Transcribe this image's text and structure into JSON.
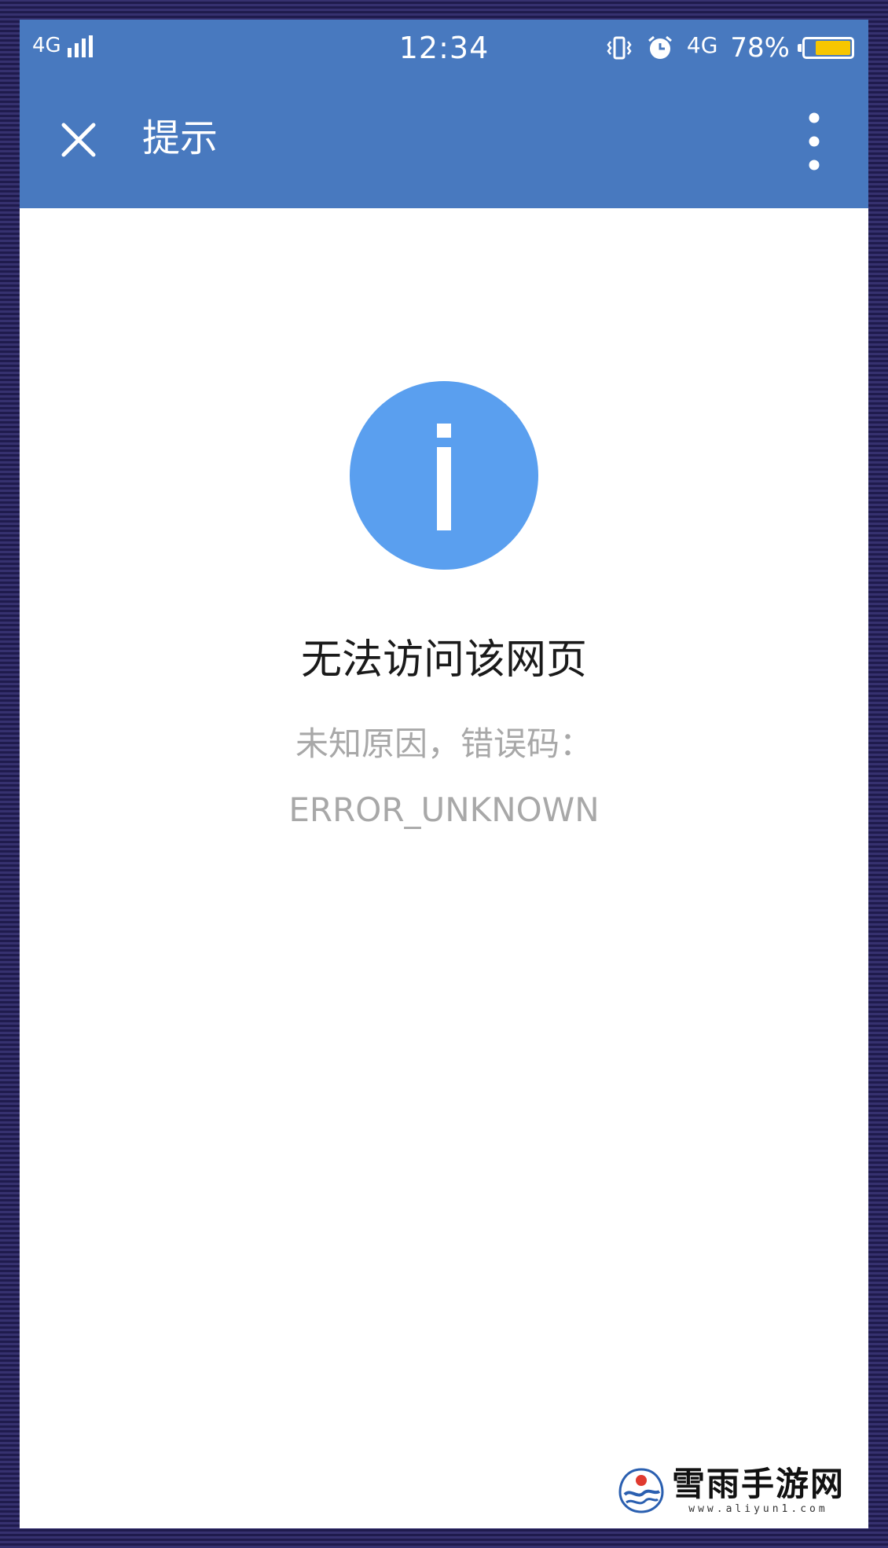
{
  "status_bar": {
    "network_left": "4G",
    "time": "12:34",
    "network_right": "4G",
    "battery_percent": "78%",
    "battery_level": 0.78,
    "icons": [
      "signal-bars-icon",
      "vibrate-icon",
      "alarm-clock-icon",
      "battery-icon"
    ]
  },
  "toolbar": {
    "title": "提示",
    "close_icon": "close-icon",
    "more_icon": "more-vertical-icon"
  },
  "content": {
    "icon": "info-icon",
    "title": "无法访问该网页",
    "reason_line": "未知原因，错误码：",
    "error_code": "ERROR_UNKNOWN"
  },
  "watermark": {
    "brand": "雪雨手游网",
    "url": "www.aliyun1.com"
  },
  "colors": {
    "header": "#4879bf",
    "info_circle": "#5a9fef",
    "battery_fill": "#f6c600",
    "secondary_text": "#a8a8a8",
    "frame": "#2e2a66"
  }
}
